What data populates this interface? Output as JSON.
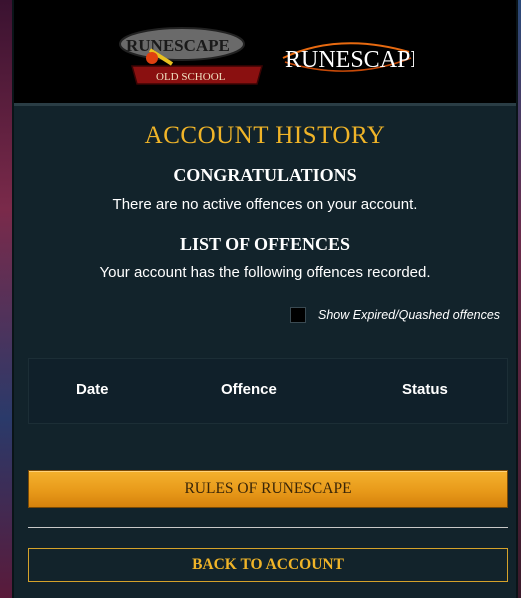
{
  "banner": {
    "logo_osrs_text": "RuneScape Old School",
    "logo_rs_text": "RuneScape"
  },
  "page": {
    "title": "ACCOUNT HISTORY"
  },
  "congrats": {
    "heading": "CONGRATULATIONS",
    "message": "There are no active offences on your account."
  },
  "offences": {
    "heading": "LIST OF OFFENCES",
    "message": "Your account has the following offences recorded.",
    "toggle_label": "Show Expired/Quashed offences",
    "toggle_checked": false,
    "columns": [
      "Date",
      "Offence",
      "Status"
    ]
  },
  "actions": {
    "rules_label": "RULES OF RUNESCAPE",
    "back_label": "BACK TO ACCOUNT"
  },
  "colors": {
    "accent_gold": "#f0b428",
    "panel_bg": "#12232b",
    "button_orange": "#e89a1a"
  }
}
